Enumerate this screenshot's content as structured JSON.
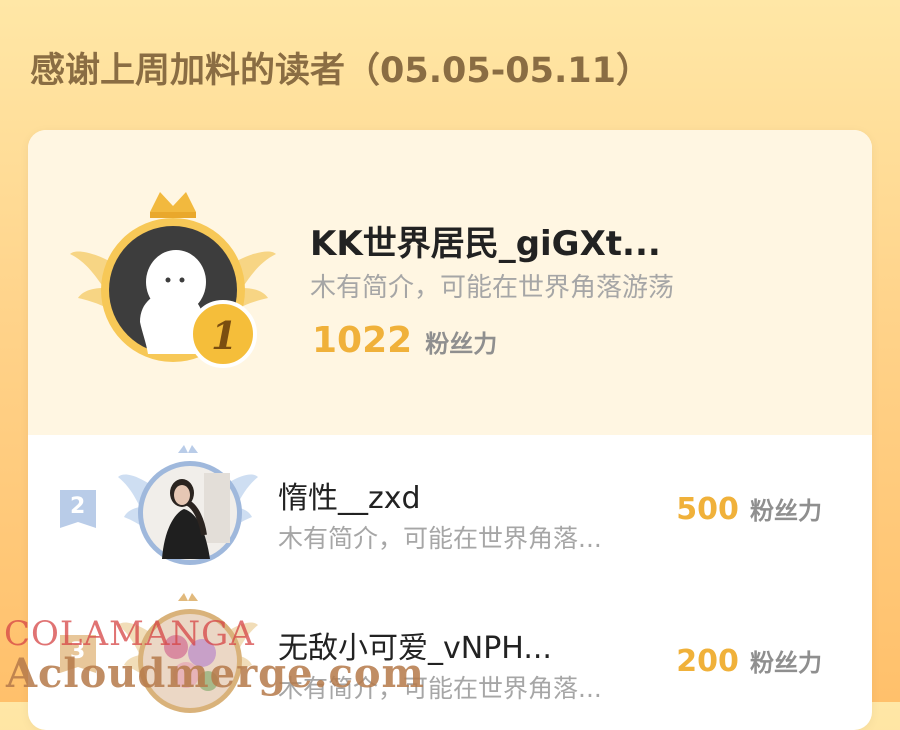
{
  "header": {
    "title": "感谢上周加料的读者（05.05-05.11）"
  },
  "top_reader": {
    "rank": "1",
    "name": "KK世界居民_giGXt...",
    "bio": "木有简介，可能在世界角落游荡",
    "fans_value": "1022",
    "fans_label": "粉丝力"
  },
  "readers": [
    {
      "rank": "2",
      "name": "惰性__zxd",
      "bio": "木有简介，可能在世界角落...",
      "fans_value": "500",
      "fans_label": "粉丝力"
    },
    {
      "rank": "3",
      "name": "无敌小可爱_vNPH...",
      "bio": "木有简介，可能在世界角落...",
      "fans_value": "200",
      "fans_label": "粉丝力"
    }
  ],
  "watermark": {
    "line1": "COLAMANGA",
    "line2": "Acloudmerge.com"
  },
  "colors": {
    "gold": "#F0B13A",
    "title_brown": "#8A6D43",
    "silver_blue": "#AFC6E6"
  }
}
